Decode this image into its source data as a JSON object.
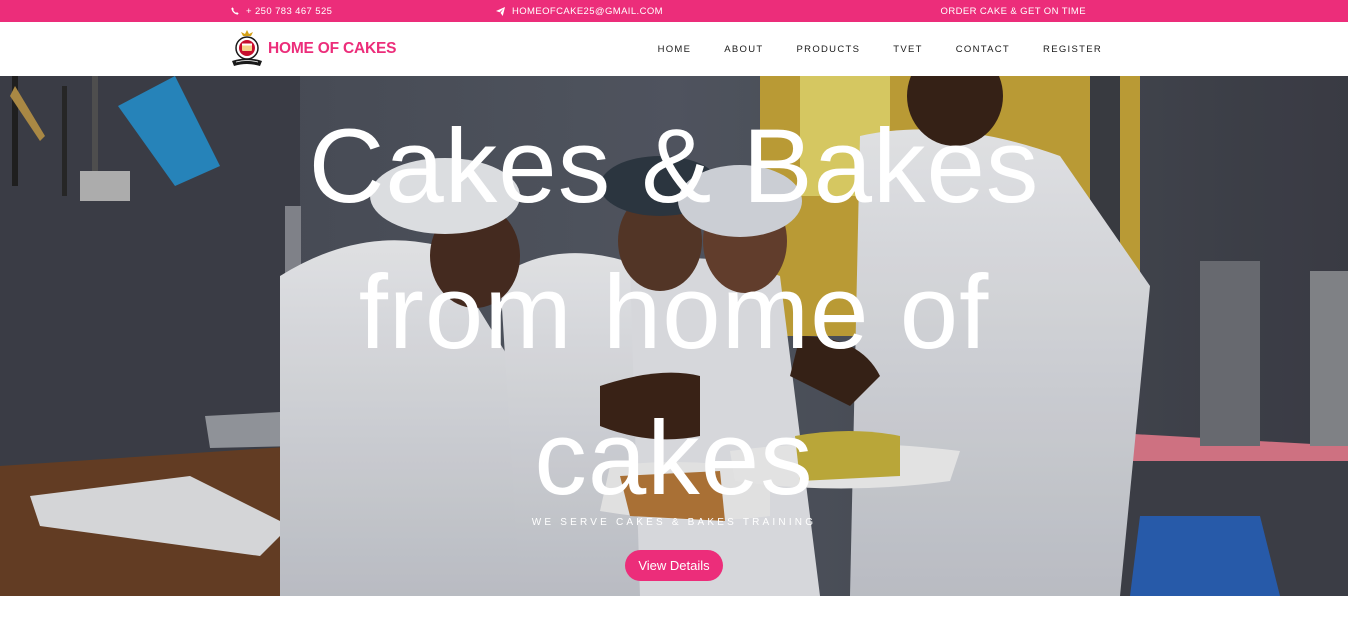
{
  "topbar": {
    "phone": "+ 250 783 467 525",
    "email": "HOMEOFCAKE25@GMAIL.COM",
    "slogan": "ORDER CAKE & GET ON TIME",
    "phone_icon": "phone-icon",
    "email_icon": "paper-plane-icon",
    "bg_color": "#ec2d7a"
  },
  "brand": {
    "name": "HOME OF CAKES",
    "logo_icon": "home-of-cakes-logo",
    "color": "#ec2d7a"
  },
  "nav": {
    "items": [
      "HOME",
      "ABOUT",
      "PRODUCTS",
      "TVET",
      "CONTACT",
      "REGISTER"
    ]
  },
  "hero": {
    "title": "Cakes & Bakes from home of cakes",
    "subtitle": "WE SERVE CAKES & BAKES TRAINING",
    "button": "View Details",
    "button_color": "#ec2d7a"
  }
}
